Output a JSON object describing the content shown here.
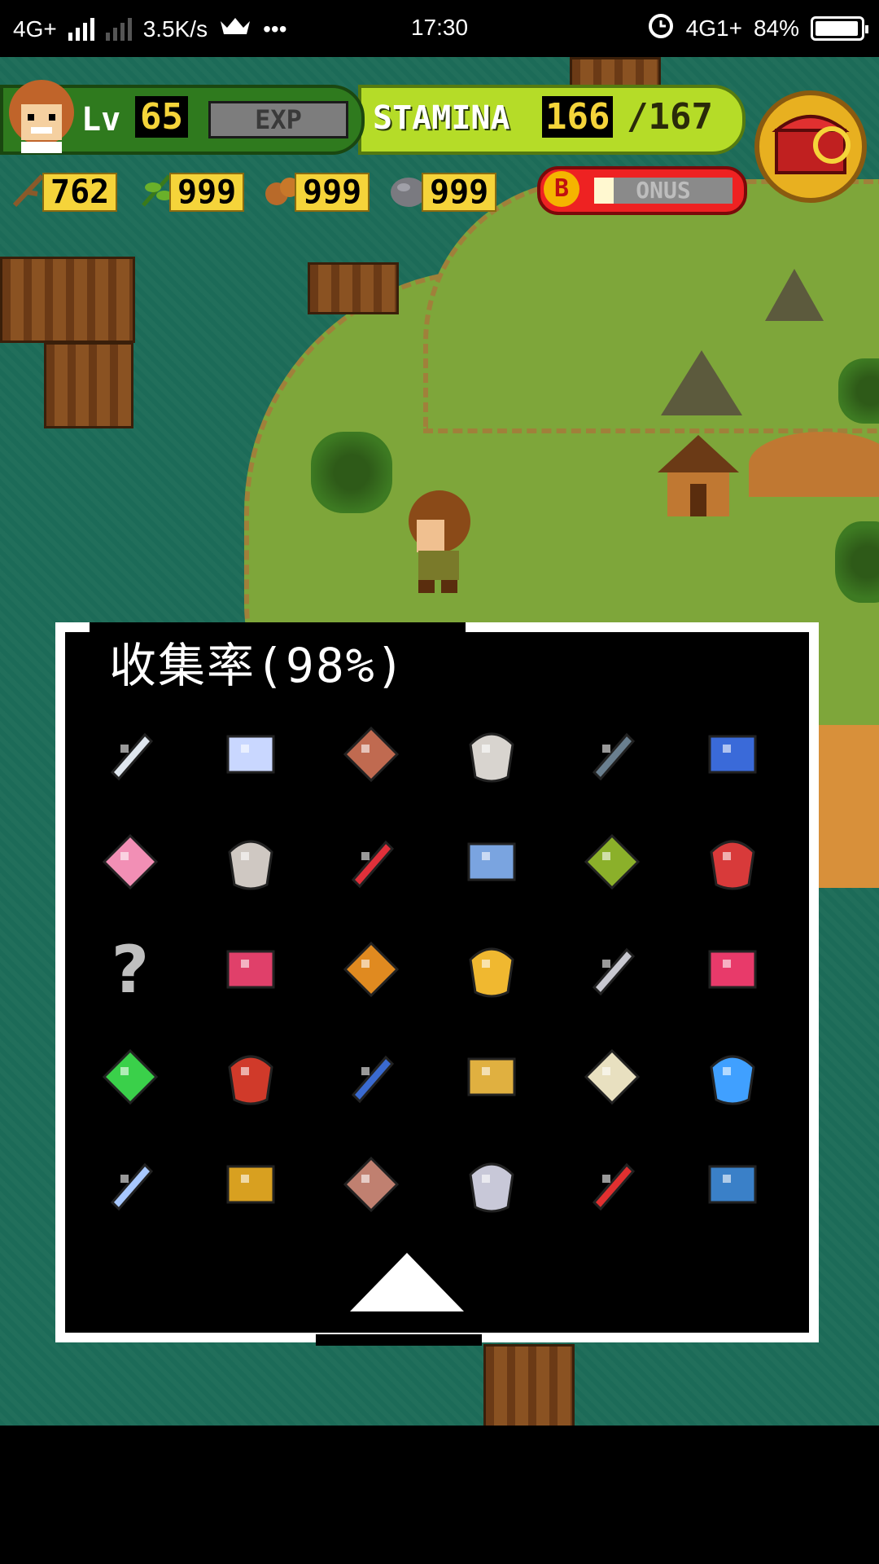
{
  "status_bar": {
    "network_left": "4G+",
    "speed": "3.5K/s",
    "dots": "•••",
    "time": "17:30",
    "network_right": "4G1+",
    "battery": "84%",
    "battery_level": 0.84
  },
  "hud": {
    "lv_label": "Lv",
    "level": "65",
    "exp_label": "EXP",
    "stamina_label": "STAMINA",
    "stamina_current": "166",
    "stamina_max": "/167",
    "bonus_letter": "B",
    "bonus_label": "ONUS",
    "resources": [
      {
        "icon": "branch-icon",
        "value": "762"
      },
      {
        "icon": "herb-icon",
        "value": "999"
      },
      {
        "icon": "nut-icon",
        "value": "999"
      },
      {
        "icon": "stone-icon",
        "value": "999"
      }
    ]
  },
  "dialog": {
    "title": "收集率(98%)",
    "items": [
      {
        "name": "phone",
        "color": "#dfe6ee"
      },
      {
        "name": "magnifier",
        "color": "#c9d7ff"
      },
      {
        "name": "vacuum",
        "color": "#c06a50"
      },
      {
        "name": "camera",
        "color": "#d8d4cf"
      },
      {
        "name": "frying-pan",
        "color": "#6a7f8f"
      },
      {
        "name": "alarm-clock",
        "color": "#3a6ad9"
      },
      {
        "name": "underwear",
        "color": "#f28fb5"
      },
      {
        "name": "ghost-plush",
        "color": "#cfc8c2"
      },
      {
        "name": "bicycle",
        "color": "#e0303a"
      },
      {
        "name": "chair",
        "color": "#7aa4e0"
      },
      {
        "name": "umbrella",
        "color": "#8bb02a"
      },
      {
        "name": "guitar",
        "color": "#d83a3a"
      },
      {
        "name": "unknown",
        "color": "#bfbfbf",
        "text": "?"
      },
      {
        "name": "piano",
        "color": "#e0406a"
      },
      {
        "name": "ring-orange",
        "color": "#e08a20"
      },
      {
        "name": "coin",
        "color": "#f0b830"
      },
      {
        "name": "ring-silver",
        "color": "#c8c8d0"
      },
      {
        "name": "ruby",
        "color": "#e83a6a"
      },
      {
        "name": "emerald",
        "color": "#3ad04a"
      },
      {
        "name": "handbag",
        "color": "#d03a2a"
      },
      {
        "name": "card",
        "color": "#3a6ad0"
      },
      {
        "name": "gold-ring",
        "color": "#e0b040"
      },
      {
        "name": "shirt",
        "color": "#e8e0c0"
      },
      {
        "name": "lightsaber",
        "color": "#40a0ff"
      },
      {
        "name": "crystal",
        "color": "#a8c8ff"
      },
      {
        "name": "gold-book",
        "color": "#d8a020"
      },
      {
        "name": "copper-key",
        "color": "#c08070"
      },
      {
        "name": "silver-key",
        "color": "#c8c8d8"
      },
      {
        "name": "dynamite",
        "color": "#e03030"
      },
      {
        "name": "blue-book",
        "color": "#3a80c8"
      }
    ]
  }
}
